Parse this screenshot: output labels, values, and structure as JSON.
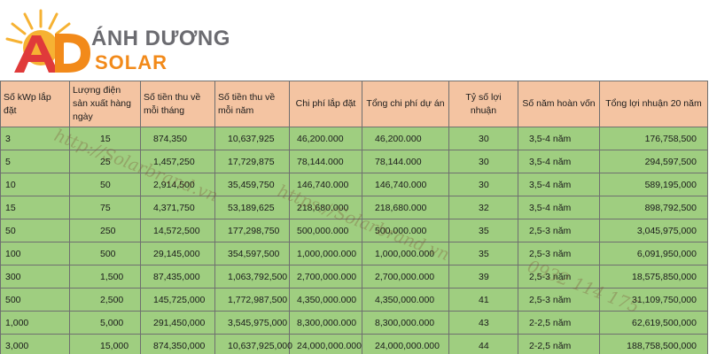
{
  "brand": {
    "name_line1": "ÁNH DƯƠNG",
    "name_line2": "SOLAR",
    "colors": {
      "orange": "#f28a1a",
      "gray": "#6b6b70",
      "red": "#e03a3a",
      "sun": "#f6b233"
    }
  },
  "table": {
    "headers": [
      "Số kWp lắp đặt",
      "Lượng điện sản xuất hàng ngày",
      "Số tiền thu về mỗi tháng",
      "Số tiền thu về mỗi năm",
      "Chi phí lắp đặt",
      "Tổng chi phí dự án",
      "Tỷ số lợi nhuận",
      "Số năm hoàn vốn",
      "Tổng lợi nhuận 20 năm"
    ],
    "rows": [
      [
        "3",
        "15",
        "874,350",
        "10,637,925",
        "46,200.000",
        "46,200.000",
        "30",
        "3,5-4 năm",
        "176,758,500"
      ],
      [
        "5",
        "25",
        "1,457,250",
        "17,729,875",
        "78,144.000",
        "78,144.000",
        "30",
        "3,5-4 năm",
        "294,597,500"
      ],
      [
        "10",
        "50",
        "2,914,500",
        "35,459,750",
        "146,740.000",
        "146,740.000",
        "30",
        "3,5-4 năm",
        "589,195,000"
      ],
      [
        "15",
        "75",
        "4,371,750",
        "53,189,625",
        "218,680.000",
        "218,680.000",
        "32",
        "3,5-4 năm",
        "898,792,500"
      ],
      [
        "50",
        "250",
        "14,572,500",
        "177,298,750",
        "500,000.000",
        "500,000.000",
        "35",
        "2,5-3 năm",
        "3,045,975,000"
      ],
      [
        "100",
        "500",
        "29,145,000",
        "354,597,500",
        "1,000,000.000",
        "1,000,000.000",
        "35",
        "2,5-3 năm",
        "6,091,950,000"
      ],
      [
        "300",
        "1,500",
        "87,435,000",
        "1,063,792,500",
        "2,700,000.000",
        "2,700,000.000",
        "39",
        "2,5-3 năm",
        "18,575,850,000"
      ],
      [
        "500",
        "2,500",
        "145,725,000",
        "1,772,987,500",
        "4,350,000.000",
        "4,350,000.000",
        "41",
        "2,5-3 năm",
        "31,109,750,000"
      ],
      [
        "1,000",
        "5,000",
        "291,450,000",
        "3,545,975,000",
        "8,300,000.000",
        "8,300,000.000",
        "43",
        "2-2,5 năm",
        "62,619,500,000"
      ],
      [
        "3,000",
        "15,000",
        "874,350,000",
        "10,637,925,000",
        "24,000,000.000",
        "24,000,000.000",
        "44",
        "2-2,5 năm",
        "188,758,500,000"
      ]
    ]
  },
  "watermark": {
    "text1": "http://Solarbrand.vn",
    "text2": "https://Solarbrand.vn",
    "text3": "0932 114 175"
  }
}
